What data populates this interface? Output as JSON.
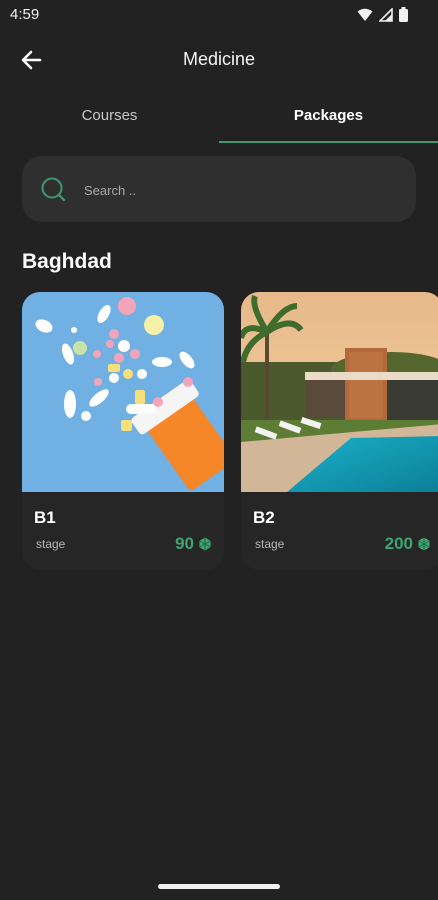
{
  "status_bar": {
    "time": "4:59",
    "icons": [
      "wifi-icon",
      "signal-icon",
      "battery-icon"
    ]
  },
  "app_bar": {
    "title": "Medicine",
    "back_icon": "arrow-left-icon"
  },
  "tabs": [
    {
      "label": "Courses",
      "selected": false
    },
    {
      "label": "Packages",
      "selected": true
    }
  ],
  "search": {
    "placeholder": "Search .."
  },
  "section": {
    "title": "Baghdad"
  },
  "packages": [
    {
      "name": "B1",
      "stage": "stage",
      "price": "90",
      "image": "pills-photo"
    },
    {
      "name": "B2",
      "stage": "stage",
      "price": "200",
      "image": "pool-house-photo"
    }
  ],
  "colors": {
    "background": "#222222",
    "accent": "#3c9a6e",
    "price": "#3fa472",
    "search_bg": "#2f2f2f"
  }
}
